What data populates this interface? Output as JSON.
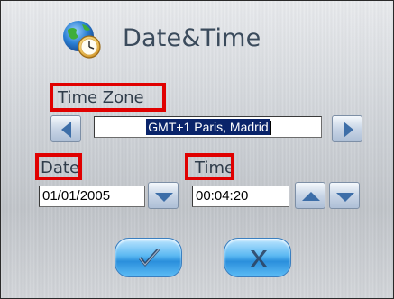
{
  "header": {
    "title": "Date&Time",
    "icon": "globe-clock-icon"
  },
  "time_zone": {
    "label": "Time Zone",
    "value": "GMT+1 Paris, Madrid",
    "prev_icon": "arrow-left-icon",
    "next_icon": "arrow-right-icon"
  },
  "date": {
    "label": "Date",
    "value": "01/01/2005",
    "dropdown_icon": "arrow-down-icon"
  },
  "time": {
    "label": "Time",
    "value": "00:04:20",
    "up_icon": "arrow-up-icon",
    "down_icon": "arrow-down-icon"
  },
  "actions": {
    "confirm_icon": "checkmark-icon",
    "cancel_icon": "x-icon"
  },
  "colors": {
    "highlight": "#e00000",
    "selection": "#0a246a",
    "button_blue": "#2a8fdc",
    "arrow_blue": "#3d6ea8"
  }
}
